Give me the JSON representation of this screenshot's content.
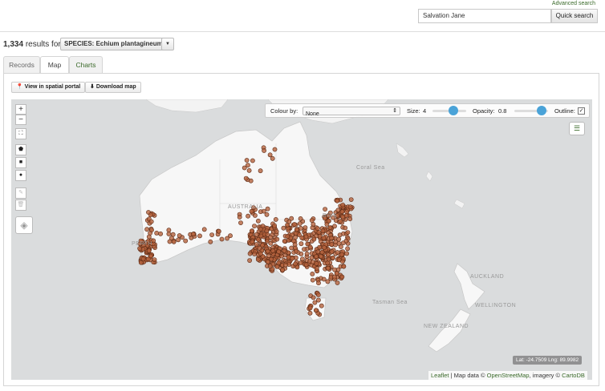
{
  "header": {
    "advanced_search": "Advanced search",
    "search_value": "Salvation Jane",
    "quick_search": "Quick search"
  },
  "results": {
    "count": "1,334",
    "suffix": "results for",
    "species": "SPECIES: Echium plantagineum"
  },
  "tabs": {
    "records": "Records",
    "map": "Map",
    "charts": "Charts"
  },
  "toolbar": {
    "spatial_portal": "View in spatial portal",
    "download_map": "Download map"
  },
  "map_options": {
    "colour_by_label": "Colour by:",
    "colour_by_value": "None",
    "size_label": "Size:",
    "size_value": "4",
    "opacity_label": "Opacity:",
    "opacity_value": "0.8",
    "outline_label": "Outline:",
    "outline_checked": true
  },
  "map_labels": {
    "australia": "AUSTRALIA",
    "coral_sea": "Coral Sea",
    "tasman_sea": "Tasman Sea",
    "new_zealand": "NEW ZEALAND",
    "auckland": "AUCKLAND",
    "wellington": "WELLINGTON",
    "perth": "PERTH",
    "brisbane": "BRIS"
  },
  "coords": "Lat: -24.7509 Lng: 89.9982",
  "attribution": {
    "leaflet": "Leaflet",
    "map_data": "| Map data ©",
    "osm": "OpenStreetMap",
    "imagery": ", imagery ©",
    "carto": "CartoDB"
  },
  "colors": {
    "point_fill": "#b5633d",
    "point_stroke": "#5a2a15",
    "accent": "#3a6a2a"
  }
}
